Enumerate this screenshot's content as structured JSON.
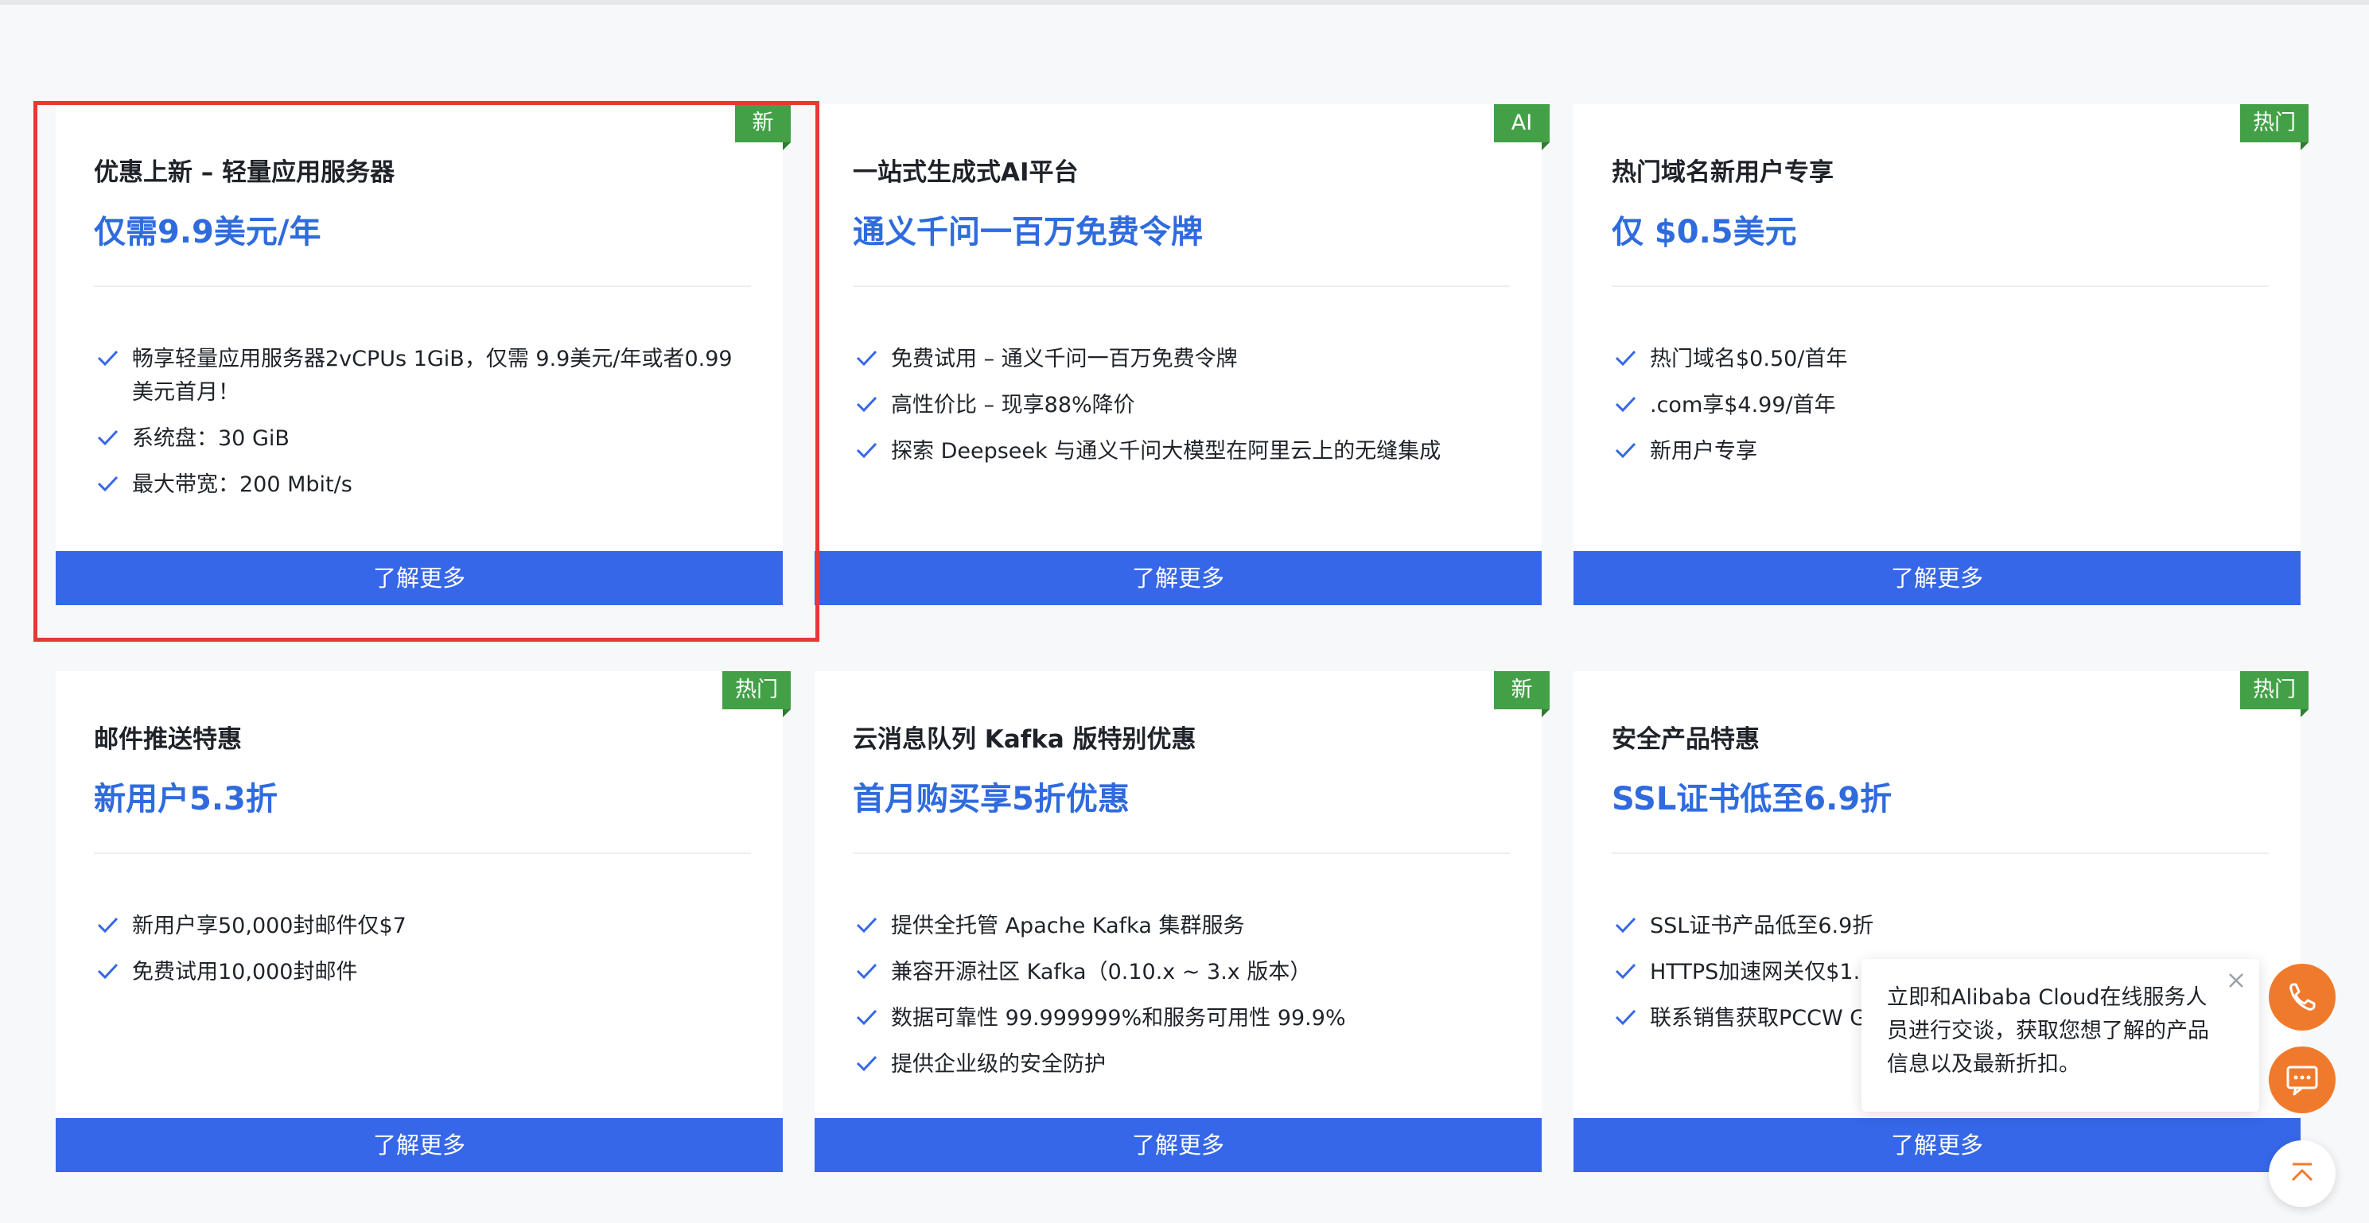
{
  "cta_label": "了解更多",
  "colors": {
    "accent": "#3567e8",
    "subtitle": "#2f6bdd",
    "badge": "#43a047",
    "highlight": "#e53935",
    "fab": "#f07a2c"
  },
  "cards": [
    {
      "badge": "新",
      "title": "优惠上新 – 轻量应用服务器",
      "subtitle": "仅需9.9美元/年",
      "features": [
        "畅享轻量应用服务器2vCPUs 1GiB，仅需 9.9美元/年或者0.99美元首月！",
        "系统盘：30 GiB",
        "最大带宽：200 Mbit/s"
      ]
    },
    {
      "badge": "AI",
      "title": "一站式生成式AI平台",
      "subtitle": "通义千问一百万免费令牌",
      "features": [
        "免费试用 – 通义千问一百万免费令牌",
        "高性价比 – 现享88%降价",
        "探索 Deepseek 与通义千问大模型在阿里云上的无缝集成"
      ]
    },
    {
      "badge": "热门",
      "title": "热门域名新用户专享",
      "subtitle": "仅 $0.5美元",
      "features": [
        "热门域名$0.50/首年",
        ".com享$4.99/首年",
        "新用户专享"
      ]
    },
    {
      "badge": "热门",
      "title": "邮件推送特惠",
      "subtitle": "新用户5.3折",
      "features": [
        "新用户享50,000封邮件仅$7",
        "免费试用10,000封邮件"
      ]
    },
    {
      "badge": "新",
      "title": "云消息队列 Kafka 版特别优惠",
      "subtitle": "首月购买享5折优惠",
      "features": [
        "提供全托管 Apache Kafka 集群服务",
        "兼容开源社区 Kafka（0.10.x ~ 3.x 版本）",
        "数据可靠性 99.999999%和服务可用性 99.9%",
        "提供企业级的安全防护"
      ]
    },
    {
      "badge": "热门",
      "title": "安全产品特惠",
      "subtitle": "SSL证书低至6.9折",
      "features": [
        "SSL证书产品低至6.9折",
        "HTTPS加速网关仅$1.60/月",
        "联系销售获取PCCW Global DDoS防护优惠"
      ]
    }
  ],
  "chat": {
    "message": "立即和Alibaba Cloud在线服务人员进行交谈，获取您想了解的产品信息以及最新折扣。"
  },
  "icons": {
    "phone": "phone-icon",
    "chat": "chat-icon",
    "top": "back-to-top-icon",
    "check": "check-icon",
    "close": "close-icon"
  }
}
